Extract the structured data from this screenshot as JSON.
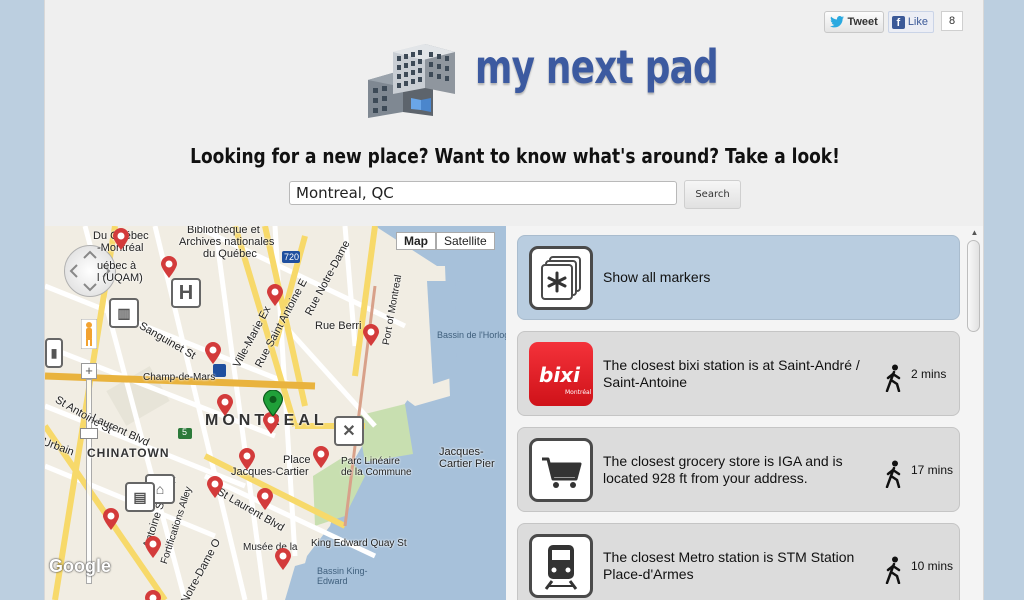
{
  "header": {
    "tweet_label": "Tweet",
    "like_label": "Like",
    "like_count": "8",
    "logo_text": "my next pad",
    "tagline": "Looking for a new place? Want to know what's around? Take a look!",
    "search_value": "Montreal, QC",
    "search_button_label": "Search"
  },
  "map": {
    "map_button": "Map",
    "satellite_button": "Satellite",
    "google_logo": "Google",
    "labels": {
      "du_quebec": "Du Québec",
      "montreal": "-Montréal",
      "quebec_a": "uébec à",
      "uqam": "l (UQAM)",
      "bibliotheque": "Bibliothèque et",
      "archives": "Archives nationales",
      "du_quebec2": "du Québec",
      "route720": "720",
      "rue_notre_dame": "Rue Notre-Dame",
      "port_montreal": "Port of Montreal",
      "sanguinet": "Sanguinet St",
      "marie": "Ville-Marie Ex",
      "st_antoine_e": "Rue Saint Antoine E",
      "rue_berri": "Rue Berri",
      "bassin_horloge": "Bassin de l'Horloge",
      "champ_de_mars": "Champ-de-Mars",
      "st_antoine_st": "St Antoine St",
      "laurent_blvd": "Laurent Blvd",
      "urbain": "Urbain",
      "montreal_big": "MONTREAL",
      "chinatown": "CHINATOWN",
      "jacques_cartier": "Jacques-Cartier",
      "place": "Place",
      "parc_lineaire": "Parc Linéaire",
      "commune": "de la Commune",
      "jc_pier": "Jacques-Cartier Pier",
      "st_laurent_blvd": "St Laurent Blvd",
      "st_st": "St",
      "antoine_st_w": "Antoine St W",
      "fortifications": "Fortifications Alley",
      "notre_dame_o": "Notre-Dame O",
      "king_edward": "King Edward Quay St",
      "musee": "Musée de la",
      "bassin_king": "Bassin King-Edward",
      "route5": "5"
    }
  },
  "panel": {
    "cards": [
      {
        "text": "Show all markers",
        "time": "",
        "icon": "asterisk-icon"
      },
      {
        "text": "The closest bixi station is at Saint-André / Saint-Antoine",
        "time": "2 mins",
        "icon": "bixi-logo",
        "bixi_logo_text": "bixi",
        "bixi_logo_sub": "Montréal"
      },
      {
        "text": "The closest grocery store is IGA and is located 928 ft from your address.",
        "time": "17 mins",
        "icon": "shopping-cart-icon"
      },
      {
        "text": "The closest Metro station is STM Station Place-d'Armes",
        "time": "10 mins",
        "icon": "metro-train-icon"
      }
    ]
  },
  "colors": {
    "logo_blue": "#3c5aa0",
    "active_card": "#b9cde0",
    "card_bg": "#dcdcdc",
    "bixi_red": "#e0232b",
    "water": "#a7c1da",
    "park": "#c8dfb0",
    "marker_red": "#d33b3b",
    "marker_green": "#20a039"
  }
}
